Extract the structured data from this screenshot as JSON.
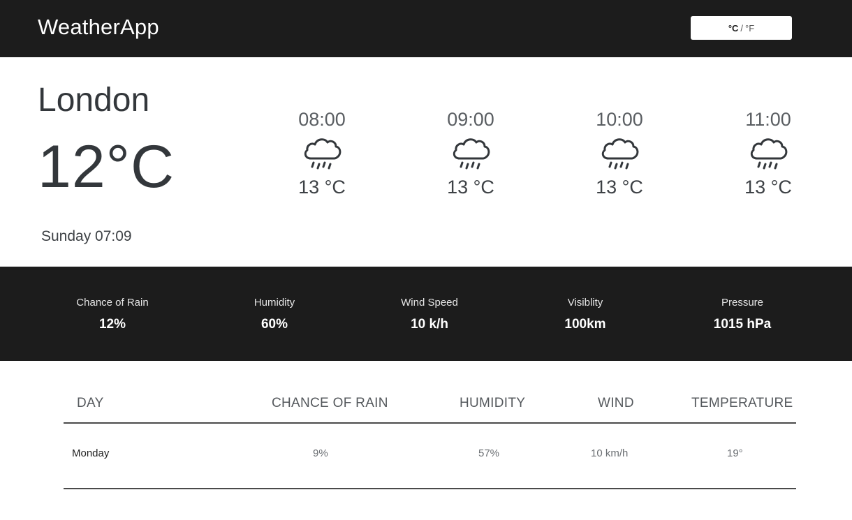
{
  "header": {
    "app_title": "WeatherApp",
    "unit_active": "°C",
    "unit_separator": "/",
    "unit_inactive": "°F"
  },
  "current": {
    "city": "London",
    "temperature": "12°C",
    "datetime": "Sunday 07:09"
  },
  "hourly": [
    {
      "time": "08:00",
      "icon": "rain-cloud-icon",
      "temp": "13 °C"
    },
    {
      "time": "09:00",
      "icon": "rain-cloud-icon",
      "temp": "13 °C"
    },
    {
      "time": "10:00",
      "icon": "rain-cloud-icon",
      "temp": "13 °C"
    },
    {
      "time": "11:00",
      "icon": "rain-cloud-icon",
      "temp": "13 °C"
    }
  ],
  "stats": [
    {
      "label": "Chance of Rain",
      "value": "12%"
    },
    {
      "label": "Humidity",
      "value": "60%"
    },
    {
      "label": "Wind Speed",
      "value": "10 k/h"
    },
    {
      "label": "Visiblity",
      "value": "100km"
    },
    {
      "label": "Pressure",
      "value": "1015 hPa"
    }
  ],
  "forecast": {
    "columns": [
      "DAY",
      "CHANCE OF RAIN",
      "HUMIDITY",
      "WIND",
      "TEMPERATURE"
    ],
    "rows": [
      {
        "day": "Monday",
        "rain": "9%",
        "humidity": "57%",
        "wind": "10 km/h",
        "temperature": "19°"
      }
    ]
  },
  "colors": {
    "bar_background": "#1c1c1c",
    "text_dark": "#33373b"
  }
}
